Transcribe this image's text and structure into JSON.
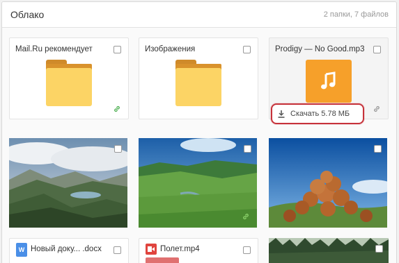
{
  "header": {
    "title": "Облако",
    "summary": "2 папки, 7 файлов"
  },
  "items": [
    {
      "type": "folder",
      "label": "Mail.Ru рекомендует",
      "shared": true
    },
    {
      "type": "folder",
      "label": "Изображения",
      "shared": false
    },
    {
      "type": "audio",
      "label": "Prodigy — No Good.mp3",
      "download_label": "Скачать 5.78 МБ",
      "shared": true
    },
    {
      "type": "image",
      "subject": "mountain lake landscape"
    },
    {
      "type": "image",
      "subject": "green valley with river",
      "shared": true
    },
    {
      "type": "image",
      "subject": "wooden barrel houses on hill"
    },
    {
      "type": "document",
      "label": "Новый доку... .docx",
      "icon_letter": "W"
    },
    {
      "type": "video",
      "label": "Полет.mp4"
    },
    {
      "type": "image",
      "subject": "forest"
    }
  ],
  "colors": {
    "folder": "#fcd465",
    "folder_tab": "#cf8a2a",
    "audio_tile": "#f6a02a",
    "download_highlight": "#c6323a",
    "link_green": "#4caf50",
    "link_gray": "#9a9a9a"
  },
  "icons": {
    "folder": "folder-icon",
    "music": "music-note-icon",
    "download": "download-icon",
    "link": "link-icon",
    "word": "word-doc-icon",
    "video": "video-icon"
  }
}
